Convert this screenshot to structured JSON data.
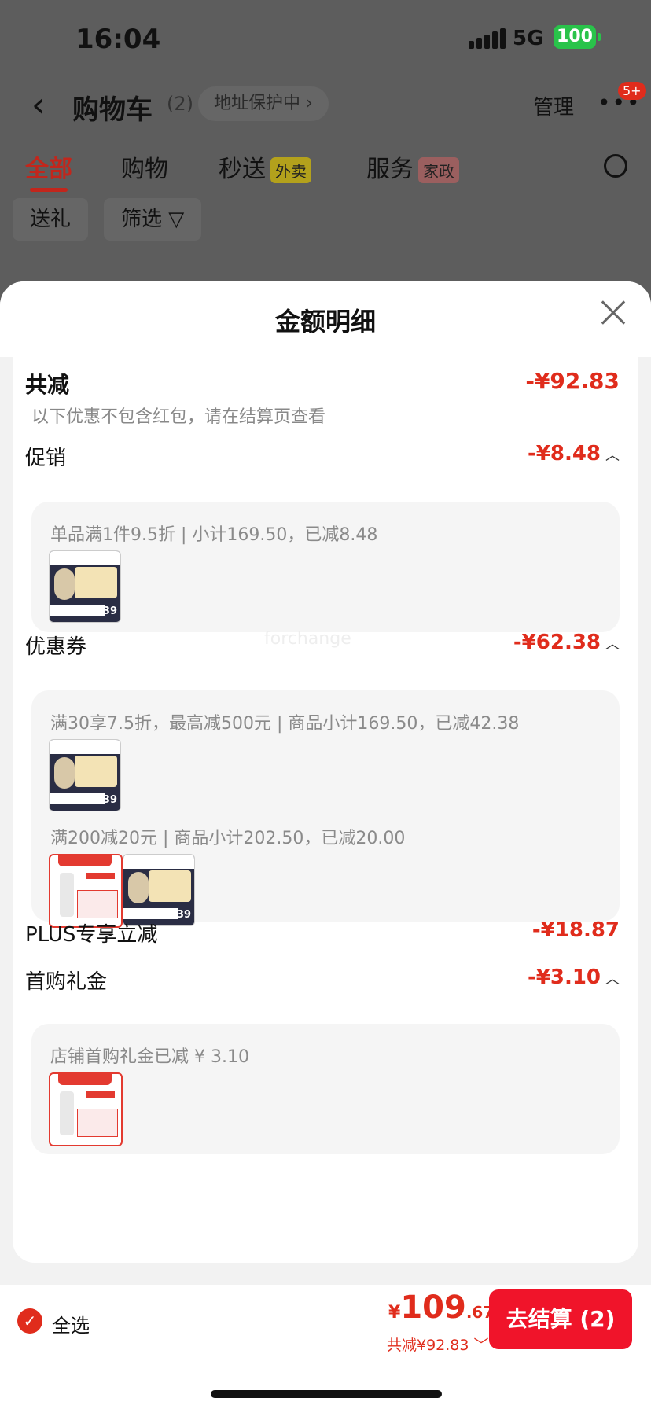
{
  "status": {
    "time": "16:04",
    "network": "5G",
    "battery": "100"
  },
  "header": {
    "back": "‹",
    "title": "购物车",
    "count": "(2)",
    "address": "地址保护中 ›",
    "manage": "管理",
    "more": "•••",
    "badge": "5+"
  },
  "tabs": [
    {
      "label": "全部"
    },
    {
      "label": "购物"
    },
    {
      "label": "秒送",
      "tag": "外卖"
    },
    {
      "label": "服务",
      "tag": "家政"
    }
  ],
  "filters": {
    "gift": "送礼",
    "filter": "筛选 ▽"
  },
  "sheet": {
    "title": "金额明细",
    "total_label": "共减",
    "total_amount": "-¥92.83",
    "total_note": "以下优惠不包含红包，请在结算页查看",
    "promo_label": "促销",
    "promo_amount": "-¥8.48",
    "promo_detail": "单品满1件9.5折 | 小计169.50，已减8.48",
    "coupon_label": "优惠券",
    "coupon_amount": "-¥62.38",
    "coupon_detail_1": "满30享7.5折，最高减500元 | 商品小计169.50，已减42.38",
    "coupon_detail_2": "满200减20元 | 商品小计202.50，已减20.00",
    "plus_label": "PLUS专享立减",
    "plus_amount": "-¥18.87",
    "gift_label": "首购礼金",
    "gift_amount": "-¥3.10",
    "gift_detail": "店铺首购礼金已减 ¥ 3.10",
    "watermark": "forchange"
  },
  "footer": {
    "select_all": "全选",
    "yen": "¥",
    "price_int": "109",
    "price_dec": ".67",
    "saved": "共减¥92.83",
    "checkout": "去结算 (2)"
  },
  "colors": {
    "accent": "#e02c1c",
    "button": "#f0142a"
  }
}
